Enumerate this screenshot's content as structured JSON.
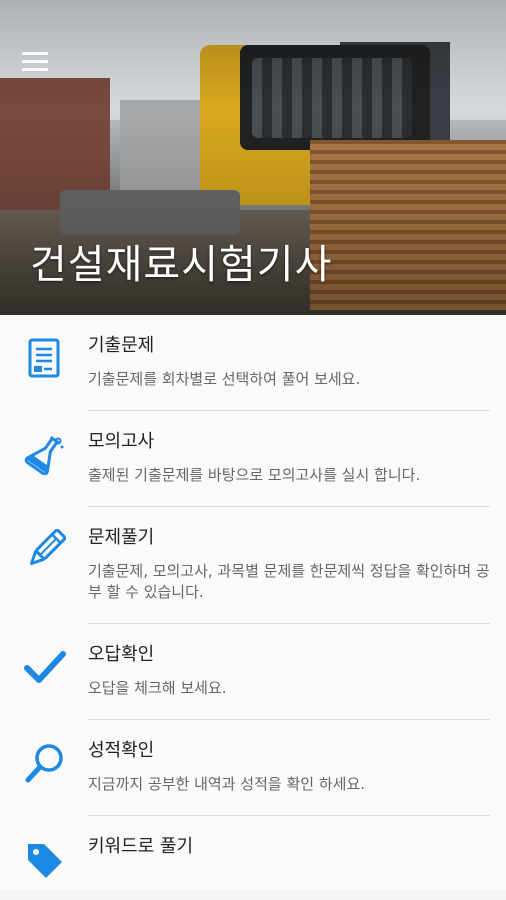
{
  "header": {
    "title": "건설재료시험기사",
    "menu_icon": "hamburger-menu-icon"
  },
  "accent_color": "#1e88e5",
  "menu_items": [
    {
      "id": "past-exams",
      "icon": "document-list-icon",
      "title": "기출문제",
      "desc": "기출문제를 회차별로 선택하여 풀어 보세요."
    },
    {
      "id": "mock-test",
      "icon": "flask-icon",
      "title": "모의고사",
      "desc": "출제된 기출문제를 바탕으로 모의고사를 실시 합니다."
    },
    {
      "id": "solve-questions",
      "icon": "pencil-icon",
      "title": "문제풀기",
      "desc": "기출문제, 모의고사, 과목별 문제를 한문제씩 정답을 확인하며 공부 할 수 있습니다."
    },
    {
      "id": "wrong-answers",
      "icon": "checkmark-icon",
      "title": "오답확인",
      "desc": "오답을 체크해 보세요."
    },
    {
      "id": "grades",
      "icon": "magnifier-icon",
      "title": "성적확인",
      "desc": "지금까지 공부한 내역과 성적을 확인 하세요."
    },
    {
      "id": "keywords",
      "icon": "tag-icon",
      "title": "키워드로 풀기",
      "desc": ""
    }
  ]
}
